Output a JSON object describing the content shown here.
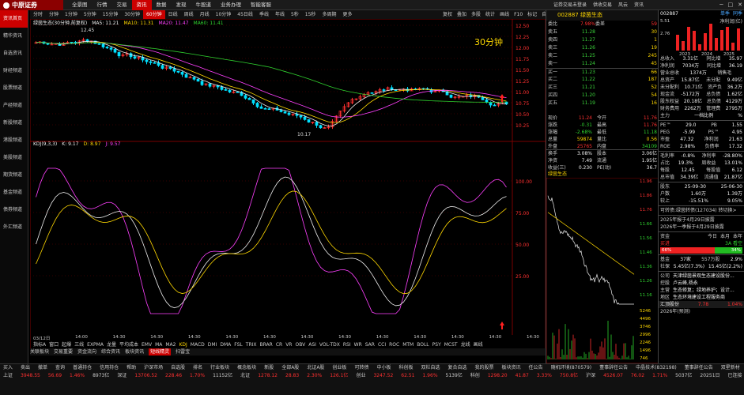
{
  "app": {
    "logo": "中原证券"
  },
  "top_menu": [
    "全景图",
    "行情",
    "交易",
    "资讯",
    "数据",
    "发现",
    "牛股道",
    "业务办理",
    "智能客服"
  ],
  "top_menu_active": 3,
  "top_right": [
    "证券交易未登录",
    "供收交易",
    "风云",
    "资讯"
  ],
  "left_nav": [
    "资讯首页",
    "精华资讯",
    "自选资讯",
    "财经频道",
    "股票频道",
    "产经频道",
    "新股频道",
    "港股频道",
    "美股频道",
    "期货频道",
    "基金频道",
    "债券频道",
    "外汇频道"
  ],
  "left_nav_active": 0,
  "periods": [
    "分时",
    "分钟",
    "1分钟",
    "5分钟",
    "15分钟",
    "30分钟",
    "60分钟",
    "日线",
    "周线",
    "月线",
    "10分钟",
    "45日线",
    "季线",
    "年线",
    "5秒",
    "15秒",
    "多周期",
    "更多"
  ],
  "period_active": 6,
  "period_tools": [
    "复权",
    "叠加",
    "多股",
    "统计",
    "画线",
    "F10",
    "标记",
    "自选"
  ],
  "chart_header": {
    "name": "绿茵生态(30分钟,前复权)",
    "ma5": "MA5: 11.21",
    "ma10": "MA10: 11.31",
    "ma20": "MA20: 11.47",
    "ma60": "MA60: 11.41"
  },
  "chart_label": "30分钟",
  "high_label": "12.45",
  "low_label": "10.17",
  "kdj_header": {
    "name": "KDJ(9,3,3)",
    "k": "K: 9.17",
    "d": "D: 8.97",
    "j": "J: 9.57"
  },
  "price_axis": [
    "12.50",
    "12.25",
    "12.00",
    "11.75",
    "11.50",
    "11.25",
    "11.00",
    "10.75",
    "10.50",
    "10.25"
  ],
  "kdj_axis": [
    "100.00",
    "75.00",
    "50.00",
    "25.00"
  ],
  "time_axis": [
    "03/12日",
    "14:00",
    "14:30",
    "14:30",
    "14:30",
    "14:30",
    "14:30",
    "14:30",
    "14:30",
    "14:30",
    "14:30",
    "14:30",
    "14:30",
    "14:30"
  ],
  "indicators": [
    "指标A",
    "窗口",
    "起爆",
    "三线",
    "EXPMA",
    "龙量",
    "平均成本",
    "EMV",
    "MA",
    "MA2",
    "KDJ",
    "MACD",
    "DMI",
    "DMA",
    "FSL",
    "TRIX",
    "BRAR",
    "CR",
    "VR",
    "OBV",
    "ASI",
    "VOL-TDX",
    "RSI",
    "WR",
    "SAR",
    "CCI",
    "ROC",
    "MTM",
    "BOLL",
    "PSY",
    "MCST",
    "龙线",
    "画线"
  ],
  "indicator_active": "KDJ",
  "bottom_tabs": [
    "关联板块",
    "交易重要",
    "资金流向",
    "综合资讯",
    "板块资讯",
    "短线精灵",
    "扫雷宝"
  ],
  "bottom_tab_active": 5,
  "stock": {
    "code": "002887",
    "name": "绿茵生态"
  },
  "orderbook": {
    "webi": {
      "label": "委比",
      "value": "7.98%",
      "label2": "委差",
      "value2": "59"
    },
    "sells": [
      {
        "l": "卖五",
        "p": "11.28",
        "v": "30"
      },
      {
        "l": "卖四",
        "p": "11.27",
        "v": "1"
      },
      {
        "l": "卖三",
        "p": "11.26",
        "v": "19"
      },
      {
        "l": "卖二",
        "p": "11.25",
        "v": "245"
      },
      {
        "l": "卖一",
        "p": "11.24",
        "v": "45"
      }
    ],
    "buys": [
      {
        "l": "买一",
        "p": "11.23",
        "v": "66"
      },
      {
        "l": "买二",
        "p": "11.22",
        "v": "187"
      },
      {
        "l": "买三",
        "p": "11.21",
        "v": "52"
      },
      {
        "l": "买四",
        "p": "11.20",
        "v": "54"
      },
      {
        "l": "买五",
        "p": "11.19",
        "v": "16"
      }
    ]
  },
  "quote_stats": [
    {
      "k": "现价",
      "v": "11.24",
      "k2": "今开",
      "v2": "11.76"
    },
    {
      "k": "涨跌",
      "v": "-0.31",
      "k2": "最高",
      "v2": "11.76"
    },
    {
      "k": "涨幅",
      "v": "-2.68%",
      "k2": "最低",
      "v2": "11.18"
    },
    {
      "k": "总量",
      "v": "59874",
      "k2": "量比",
      "v2": "0.56"
    },
    {
      "k": "外盘",
      "v": "25765",
      "k2": "内盘",
      "v2": "34109"
    },
    {
      "k": "换手",
      "v": "3.08%",
      "k2": "股本",
      "v2": "3.06亿"
    },
    {
      "k": "净资",
      "v": "7.49",
      "k2": "流通",
      "v2": "1.95亿"
    },
    {
      "k": "收益(三)",
      "v": "0.230",
      "k2": "PE(动)",
      "v2": "36.7"
    }
  ],
  "mini_chart": {
    "title": "绿茵生态",
    "axis": [
      "11.96",
      "11.86",
      "11.76",
      "11.66",
      "11.56",
      "11.46",
      "11.36",
      "11.26",
      "11.16"
    ],
    "vol_axis": [
      "5246",
      "4496",
      "3746",
      "2996",
      "2246",
      "1496",
      "746"
    ]
  },
  "fin": {
    "code": "002887",
    "tabs": [
      "单季",
      "同季"
    ],
    "label": "净利润(亿)",
    "values": [
      "5.51",
      "2.76"
    ],
    "years": [
      "2023",
      "2024",
      "2025"
    ],
    "rows": [
      {
        "k": "总收入",
        "a": "3.31亿",
        "b": "同比增",
        "c": "35.97"
      },
      {
        "k": "净利润",
        "a": "7034万",
        "b": "同比增",
        "c": "36.19"
      },
      {
        "k": "营业总收",
        "a": "1374万",
        "b": "销售毛",
        "c": ""
      },
      {
        "k": "总资产",
        "a": "15.87亿",
        "b": "未分配",
        "c": "9.49亿"
      },
      {
        "k": "未分配利",
        "a": "10.71亿",
        "b": "资产负",
        "c": "36.2万"
      },
      {
        "k": "现金流",
        "a": "-5172万",
        "b": "总负债",
        "c": "1.62亿"
      },
      {
        "k": "股东权益",
        "a": "20.18亿",
        "b": "总负债",
        "c": "4129万"
      },
      {
        "k": "财务费用",
        "a": "2262万",
        "b": "管理费",
        "c": "2795万"
      },
      {
        "k": "主力",
        "a": "一档比例",
        "b": "",
        "c": "%"
      }
    ],
    "ratios": [
      {
        "k": "PE™",
        "a": "29.0",
        "b": "PB",
        "c": "1.55"
      },
      {
        "k": "PEG",
        "a": "-5.99",
        "b": "PS™",
        "c": "4.95"
      },
      {
        "k": "市盈",
        "a": "47.32",
        "b": "净利润",
        "c": "21.63"
      },
      {
        "k": "ROE",
        "a": "2.98%",
        "b": "负债率",
        "c": "17.32"
      }
    ],
    "growth": [
      {
        "k": "毛利率",
        "a": "-0.8%",
        "b": "净利率",
        "c": "-28.80%"
      },
      {
        "k": "占比",
        "a": "19.3%",
        "b": "周收益",
        "c": "13.01%"
      },
      {
        "k": "每股",
        "a": "12.45",
        "b": "每股值",
        "c": "6.12"
      },
      {
        "k": "总市值",
        "a": "34.39亿",
        "b": "流通值",
        "c": "21.87亿"
      }
    ],
    "holders": [
      {
        "k": "股东",
        "a": "25-09-30",
        "c": "25-06-30"
      },
      {
        "k": "户数",
        "a": "1.60万",
        "c": "1.39万"
      },
      {
        "k": "较上",
        "a": "-15.51%",
        "c": "9.05%"
      }
    ],
    "bond": "可转债:绿茵转债(127034) 转切换>",
    "reports": [
      "2025年报于4月29日披露",
      "2026年一季报于4月29日披露"
    ],
    "flow": {
      "label": "资金",
      "tabs": [
        "今日",
        "本月",
        "本年"
      ],
      "in": "66%",
      "out": "34%",
      "buy_label": "买进",
      "sell_label": "3A 看空"
    },
    "funds": [
      {
        "k": "基金",
        "a": "37家",
        "b": "557万股",
        "c": "2.9%"
      },
      {
        "k": "社保",
        "a": "5.45亿(7.3%)",
        "b": "",
        "c": "15.45亿(2.2%)"
      }
    ],
    "company": [
      {
        "k": "公司",
        "v": "天津绿茵景观生态建设股份..."
      },
      {
        "k": "控股",
        "v": "卢云峰,杨永"
      },
      {
        "k": "主营",
        "v": "生态修复；绿地养护；设计..."
      },
      {
        "k": "地区",
        "v": "生态环境建设工程服务商"
      }
    ],
    "peer": {
      "label": "汇顶股份",
      "p": "7.78",
      "c": "1.04%"
    },
    "date": "2026年(预测)"
  },
  "status_rows": [
    [
      "买入",
      "卖出",
      "撤单",
      "查询",
      "普通持仓",
      "信用持仓",
      "帮助",
      "沪深市场",
      "自选股",
      "排名",
      "行业板块",
      "概念板块",
      "新股",
      "全部A股",
      "北证A股",
      "创业板",
      "可转债",
      "中小板",
      "科创板",
      "双栏自选",
      "复合自选",
      "我的股票",
      "板块资讯",
      "任公告",
      "随机环境(870579)",
      "董事辞任公告",
      "中晶技术(832198)",
      "董事辞任公告",
      "双星新材",
      "投资者关系活动"
    ],
    [
      "上证",
      "3948.55",
      "56.69",
      "1.46%",
      "8973亿",
      "深证",
      "13706.52",
      "228.46",
      "1.70%",
      "11152亿",
      "北证",
      "1278.12",
      "28.83",
      "2.30%",
      "126.1亿",
      "创业",
      "3247.52",
      "62.51",
      "1.96%",
      "5139亿",
      "科创",
      "1298.20",
      "41.87",
      "3.33%",
      "750.8亿",
      "沪深",
      "4526.07",
      "76.02",
      "1.71%",
      "5037亿",
      "20251日",
      "已连接"
    ]
  ]
}
